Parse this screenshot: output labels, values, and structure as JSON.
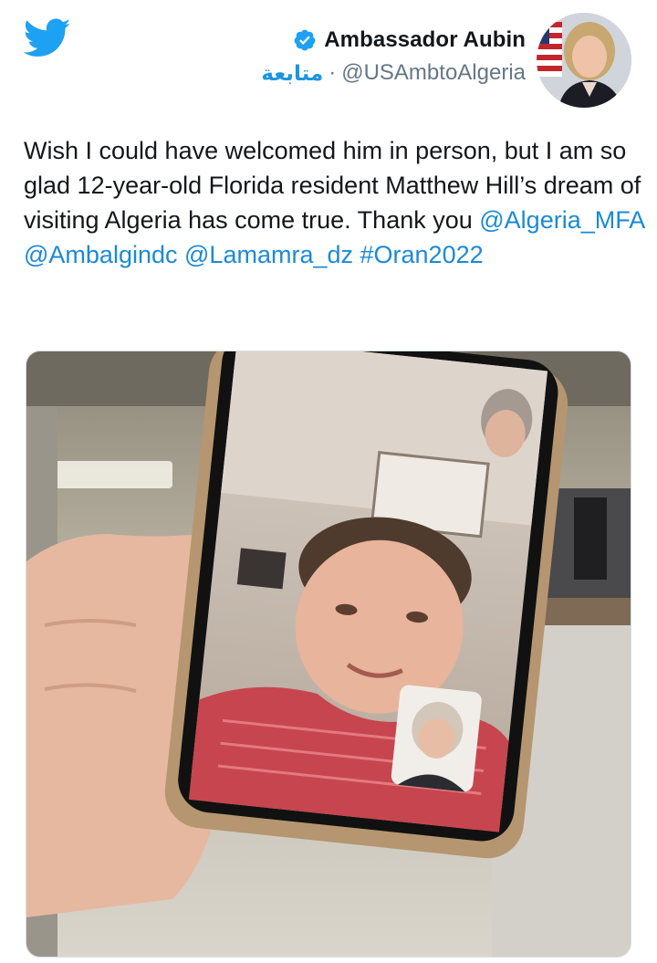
{
  "app": {
    "logo_icon": "twitter-bird-icon",
    "brand_color": "#1da1f2"
  },
  "author": {
    "display_name": "Ambassador Aubin",
    "verified_icon": "verified-badge-icon",
    "handle": "@USAmbtoAlgeria",
    "separator": "·",
    "follow_label": "متابعة",
    "avatar_icon": "profile-avatar-icon"
  },
  "tweet": {
    "text_1": "Wish I could have welcomed him in person, but I am so glad 12-year-old Florida resident Matthew Hill’s dream of visiting Algeria has come true. Thank you ",
    "mention_1": "@Algeria_MFA",
    "space_1": " ",
    "mention_2": "@Ambalgindc",
    "space_2": " ",
    "mention_3": "@Lamamra_dz",
    "space_3": " ",
    "hashtag_1": "#Oran2022",
    "link_color": "#1b8ad6"
  },
  "media": {
    "image_icon": "tweet-photo-video-call"
  }
}
